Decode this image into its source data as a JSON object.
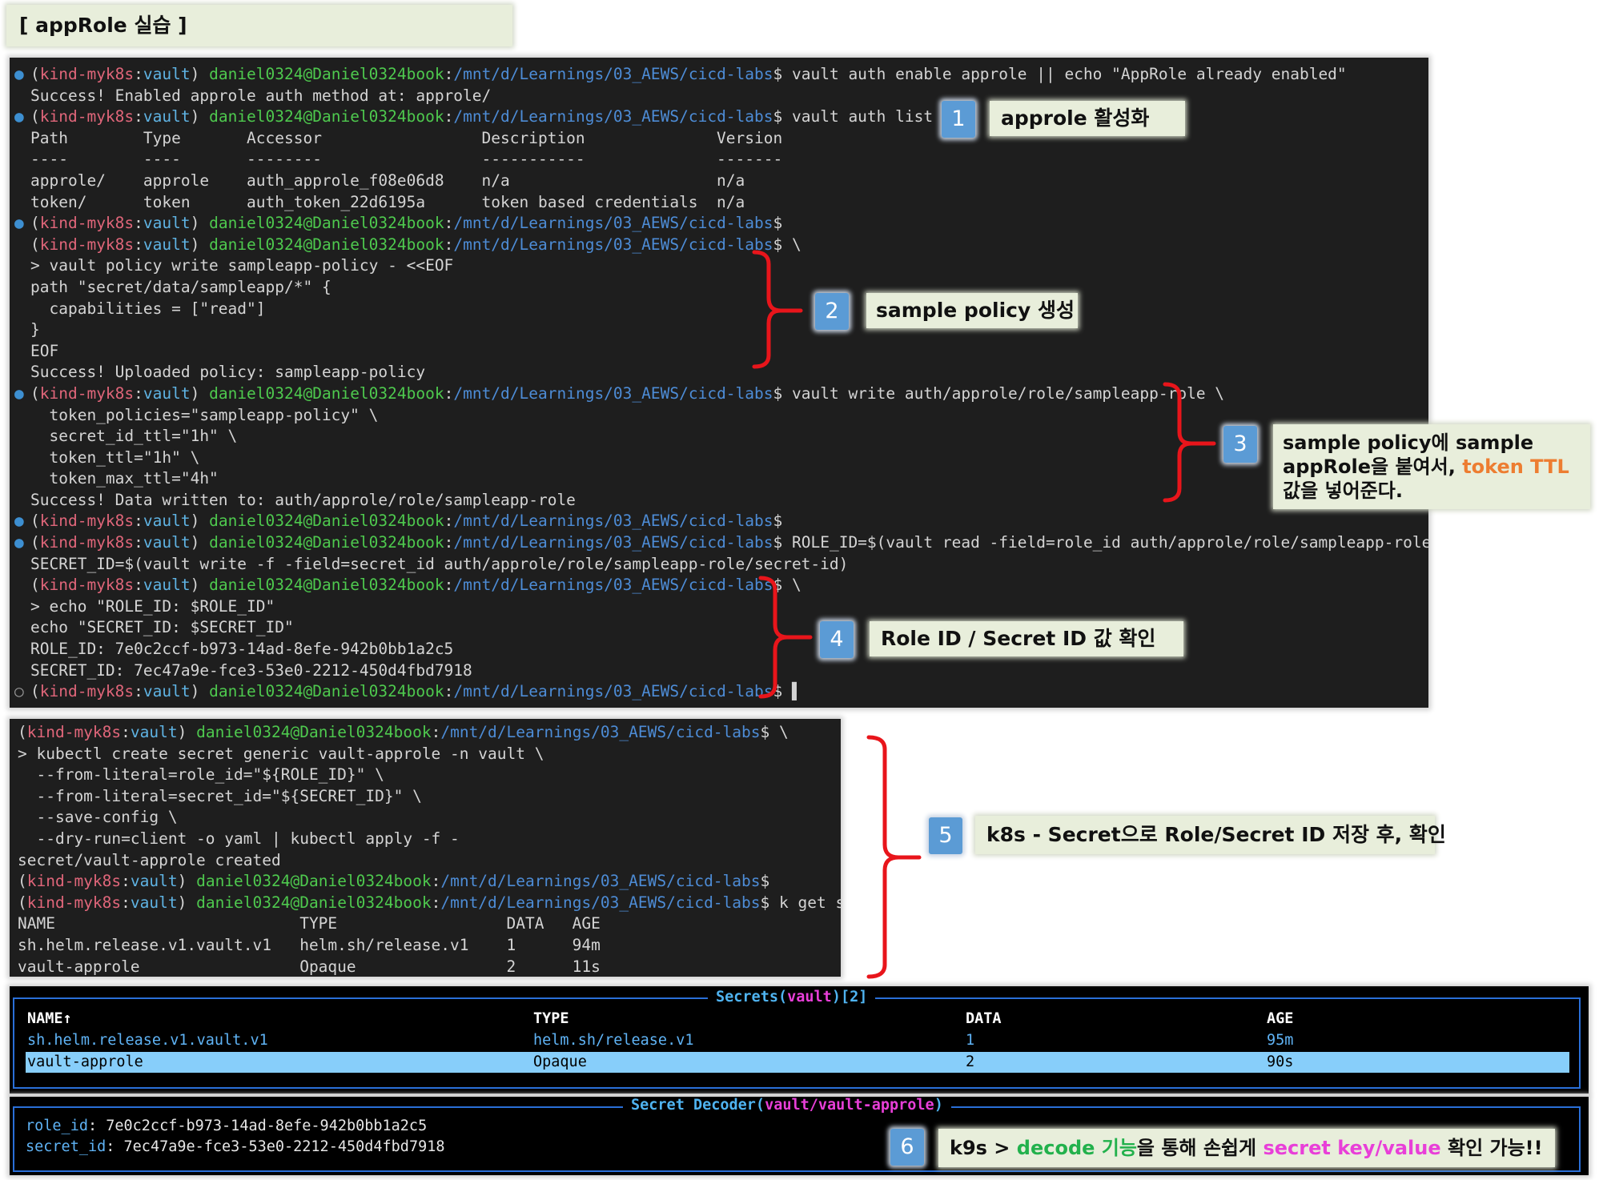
{
  "page_title": "[ appRole 실습 ]",
  "terminal1": {
    "lines": [
      {
        "dot": "on",
        "prompt": true,
        "cmd": " vault auth enable approle || echo \"AppRole already enabled\""
      },
      {
        "dot": "",
        "prompt": false,
        "text": "Success! Enabled approle auth method at: approle/"
      },
      {
        "dot": "on",
        "prompt": true,
        "cmd": " vault auth list"
      },
      {
        "dot": "",
        "prompt": false,
        "text": "Path        Type       Accessor                 Description              Version"
      },
      {
        "dot": "",
        "prompt": false,
        "text": "----        ----       --------                 -----------              -------"
      },
      {
        "dot": "",
        "prompt": false,
        "text": "approle/    approle    auth_approle_f08e06d8    n/a                      n/a"
      },
      {
        "dot": "",
        "prompt": false,
        "text": "token/      token      auth_token_22d6195a      token based credentials  n/a"
      },
      {
        "dot": "on",
        "prompt": true,
        "cmd": ""
      },
      {
        "dot": "",
        "prompt": true,
        "cmd": " \\"
      },
      {
        "dot": "",
        "prompt": false,
        "text": "> vault policy write sampleapp-policy - <<EOF"
      },
      {
        "dot": "",
        "prompt": false,
        "text": "path \"secret/data/sampleapp/*\" {"
      },
      {
        "dot": "",
        "prompt": false,
        "text": "  capabilities = [\"read\"]"
      },
      {
        "dot": "",
        "prompt": false,
        "text": "}"
      },
      {
        "dot": "",
        "prompt": false,
        "text": "EOF"
      },
      {
        "dot": "",
        "prompt": false,
        "text": "Success! Uploaded policy: sampleapp-policy"
      },
      {
        "dot": "on",
        "prompt": true,
        "cmd": " vault write auth/approle/role/sampleapp-role \\"
      },
      {
        "dot": "",
        "prompt": false,
        "text": "  token_policies=\"sampleapp-policy\" \\"
      },
      {
        "dot": "",
        "prompt": false,
        "text": "  secret_id_ttl=\"1h\" \\"
      },
      {
        "dot": "",
        "prompt": false,
        "text": "  token_ttl=\"1h\" \\"
      },
      {
        "dot": "",
        "prompt": false,
        "text": "  token_max_ttl=\"4h\""
      },
      {
        "dot": "",
        "prompt": false,
        "text": "Success! Data written to: auth/approle/role/sampleapp-role"
      },
      {
        "dot": "on",
        "prompt": true,
        "cmd": ""
      },
      {
        "dot": "on",
        "prompt": true,
        "cmd": " ROLE_ID=$(vault read -field=role_id auth/approle/role/sampleapp-role/role-id)"
      },
      {
        "dot": "",
        "prompt": false,
        "text": "SECRET_ID=$(vault write -f -field=secret_id auth/approle/role/sampleapp-role/secret-id)"
      },
      {
        "dot": "",
        "prompt": true,
        "cmd": " \\"
      },
      {
        "dot": "",
        "prompt": false,
        "text": "> echo \"ROLE_ID: $ROLE_ID\""
      },
      {
        "dot": "",
        "prompt": false,
        "text": "echo \"SECRET_ID: $SECRET_ID\""
      },
      {
        "dot": "",
        "prompt": false,
        "text": "ROLE_ID: 7e0c2ccf-b973-14ad-8efe-942b0bb1a2c5"
      },
      {
        "dot": "",
        "prompt": false,
        "text": "SECRET_ID: 7ec47a9e-fce3-53e0-2212-450d4fbd7918"
      },
      {
        "dot": "off",
        "prompt": true,
        "cmd": " ▌"
      }
    ]
  },
  "prompt": {
    "kind": "kind-myk8s",
    "vault": "vault",
    "user": "daniel0324@Daniel0324book",
    "path": "/mnt/d/Learnings/03_AEWS/cicd-labs"
  },
  "terminal2": {
    "lines": [
      {
        "prompt": true,
        "cmd": " \\"
      },
      {
        "prompt": false,
        "text": "> kubectl create secret generic vault-approle -n vault \\"
      },
      {
        "prompt": false,
        "text": "  --from-literal=role_id=\"${ROLE_ID}\" \\"
      },
      {
        "prompt": false,
        "text": "  --from-literal=secret_id=\"${SECRET_ID}\" \\"
      },
      {
        "prompt": false,
        "text": "  --save-config \\"
      },
      {
        "prompt": false,
        "text": "  --dry-run=client -o yaml | kubectl apply -f -"
      },
      {
        "prompt": false,
        "text": "secret/vault-approle created"
      },
      {
        "prompt": true,
        "cmd": ""
      },
      {
        "prompt": true,
        "cmd": " k get secret"
      },
      {
        "prompt": false,
        "text": "NAME                          TYPE                  DATA   AGE"
      },
      {
        "prompt": false,
        "text": "sh.helm.release.v1.vault.v1   helm.sh/release.v1    1      94m"
      },
      {
        "prompt": false,
        "text": "vault-approle                 Opaque                2      11s"
      }
    ]
  },
  "callouts": {
    "c1": {
      "num": "1",
      "text": "approle  활성화"
    },
    "c2": {
      "num": "2",
      "text": "sample policy 생성"
    },
    "c3": {
      "num": "3",
      "line1": "sample policy에 sample",
      "line2a": "appRole을 붙여서, ",
      "line2b": "token TTL",
      "line3": "값을 넣어준다."
    },
    "c4": {
      "num": "4",
      "text": "Role ID / Secret ID 값 확인"
    },
    "c5": {
      "num": "5",
      "text": "k8s - Secret으로 Role/Secret ID 저장 후, 확인"
    },
    "c6": {
      "num": "6",
      "pre": "k9s > ",
      "green": "decode 기능",
      "mid": "을 통해 손쉽게 ",
      "pink": "secret key/value",
      "post": " 확인 가능!!"
    }
  },
  "k9s_secrets": {
    "title_pre": "Secrets(",
    "title_ns": "vault",
    "title_post": ")[2]",
    "headers": [
      "NAME↑",
      "TYPE",
      "DATA",
      "AGE"
    ],
    "rows": [
      [
        "sh.helm.release.v1.vault.v1",
        "helm.sh/release.v1",
        "1",
        "95m"
      ],
      [
        "vault-approle",
        "Opaque",
        "2",
        "90s"
      ]
    ]
  },
  "k9s_decoder": {
    "title_pre": "Secret Decoder(",
    "title_ns": "vault/vault-approle",
    "title_post": ")",
    "items": [
      {
        "key": "role_id",
        "value": ": 7e0c2ccf-b973-14ad-8efe-942b0bb1a2c5"
      },
      {
        "key": "secret_id",
        "value": ": 7ec47a9e-fce3-53e0-2212-450d4fbd7918"
      }
    ]
  },
  "colors": {
    "callout_bg": "#e8eedb",
    "badge": "#5b9bd5",
    "bracket": "#e8151b",
    "highlight_orange": "#ed7d31",
    "highlight_green": "#22b14c",
    "highlight_pink": "#e83fd8",
    "k9s_border": "#2a6fd8",
    "k9s_selected": "#87cefa"
  }
}
